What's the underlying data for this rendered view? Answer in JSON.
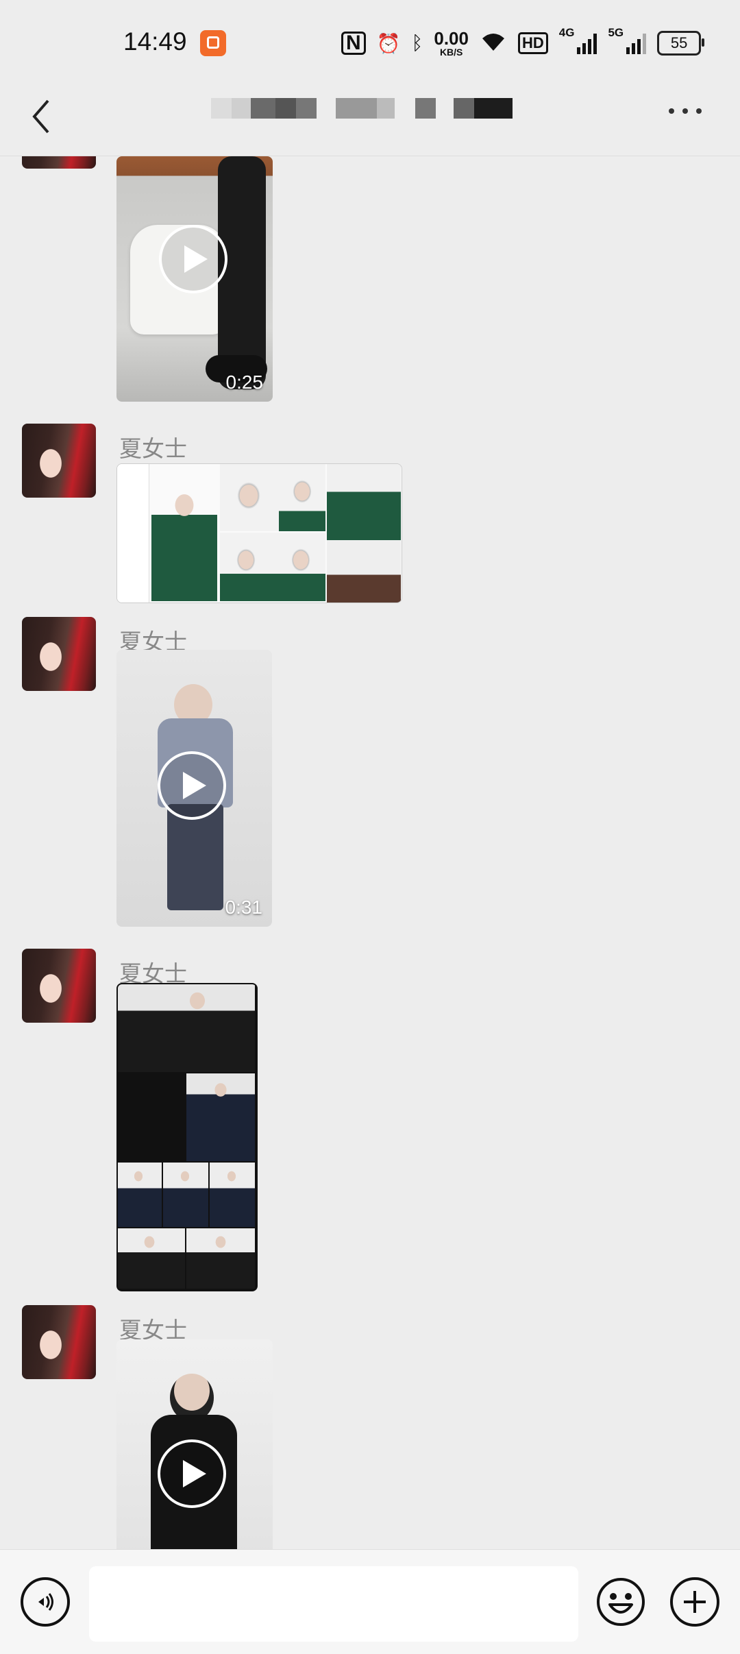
{
  "status_bar": {
    "time": "14:49",
    "speed_value": "0.00",
    "speed_unit": "KB/S",
    "hd_label": "HD",
    "net1": "4G",
    "net2": "5G",
    "battery": "55"
  },
  "nav": {
    "back_icon": "chevron-left-icon",
    "more_icon": "more-dots-icon"
  },
  "messages": [
    {
      "type": "video",
      "duration": "0:25"
    },
    {
      "type": "image",
      "sender": "夏女士"
    },
    {
      "type": "video",
      "sender": "夏女士",
      "duration": "0:31"
    },
    {
      "type": "image",
      "sender": "夏女士"
    },
    {
      "type": "video",
      "sender": "夏女士"
    }
  ],
  "input_bar": {
    "voice_icon": "voice-icon",
    "emoji_icon": "emoji-icon",
    "plus_icon": "plus-icon",
    "placeholder": ""
  }
}
